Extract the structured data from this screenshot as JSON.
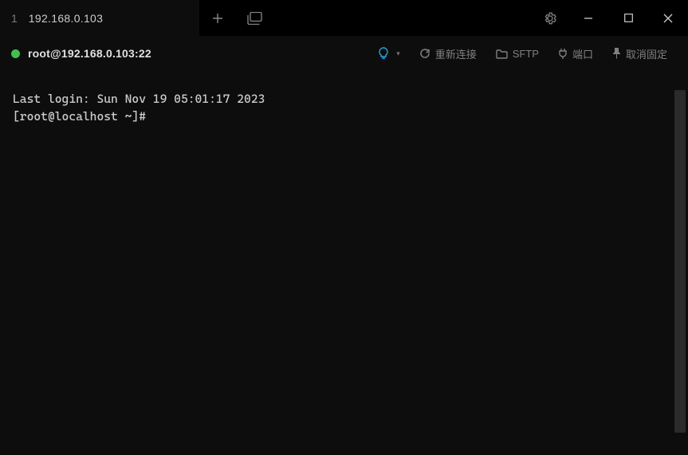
{
  "titlebar": {
    "tab_index": "1",
    "tab_title": "192.168.0.103"
  },
  "sessionbar": {
    "title": "root@192.168.0.103:22",
    "reconnect_label": "重新连接",
    "sftp_label": "SFTP",
    "port_label": "端口",
    "unpin_label": "取消固定"
  },
  "terminal": {
    "line1": "Last login: Sun Nov 19 05:01:17 2023",
    "prompt": "[root@localhost ~]#"
  }
}
